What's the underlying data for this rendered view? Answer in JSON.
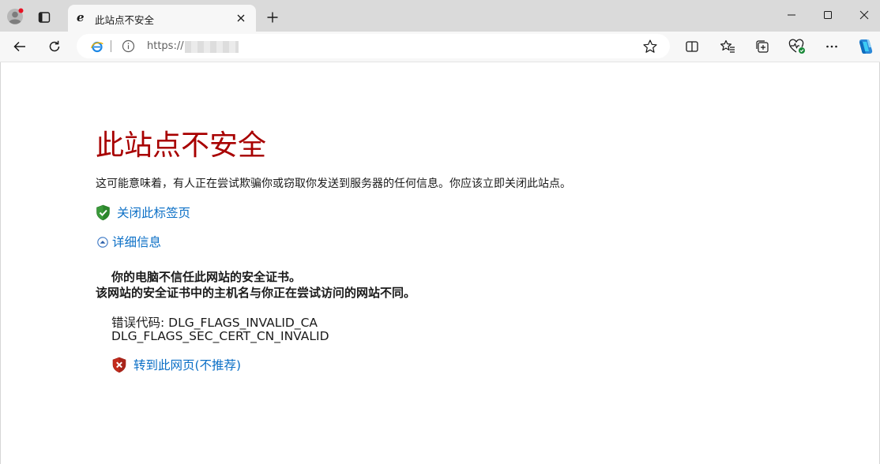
{
  "browser": {
    "tab": {
      "title": "此站点不安全"
    },
    "address": {
      "url_prefix": "https://"
    },
    "icons": {
      "profile": "profile-avatar-icon",
      "tab_actions": "tab-actions-icon",
      "favicon": "edge-ie-mode-icon",
      "close_tab": "close-icon",
      "new_tab": "plus-icon",
      "minimize": "minimize-icon",
      "maximize": "maximize-icon",
      "close_window": "close-icon",
      "back": "back-arrow-icon",
      "refresh": "refresh-icon",
      "info": "info-icon",
      "favorite": "star-icon",
      "split_screen": "split-screen-icon",
      "favorites": "favorites-icon",
      "collections": "collections-icon",
      "browser_essentials": "heart-pulse-icon",
      "more": "more-icon",
      "copilot": "copilot-icon"
    }
  },
  "page": {
    "title": "此站点不安全",
    "description": "这可能意味着，有人正在尝试欺骗你或窃取你发送到服务器的任何信息。你应该立即关闭此站点。",
    "close_tab_link": "关闭此标签页",
    "details_link": "详细信息",
    "message_line1": "你的电脑不信任此网站的安全证书。",
    "message_line2": "该网站的安全证书中的主机名与你正在尝试访问的网站不同。",
    "error_code_line1": "错误代码: DLG_FLAGS_INVALID_CA",
    "error_code_line2": "DLG_FLAGS_SEC_CERT_CN_INVALID",
    "proceed_link": "转到此网页(不推荐)"
  },
  "colors": {
    "title_red": "#a80000",
    "link_blue": "#0b6fc6",
    "titlebar": "#dadada",
    "toolbar": "#f7f7f7",
    "shield_green": "#3a9a3a",
    "shield_red": "#c42b1c"
  }
}
